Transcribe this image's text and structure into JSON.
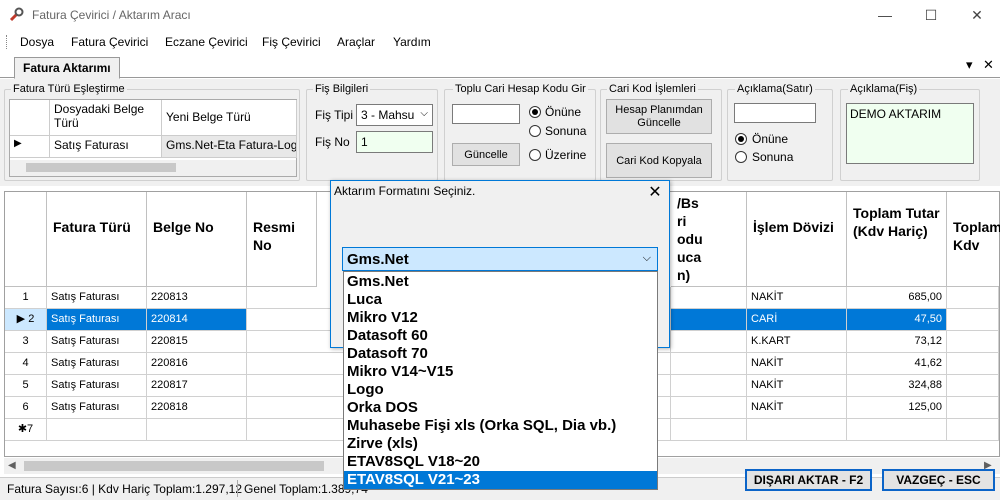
{
  "window": {
    "title": "Fatura Çevirici / Aktarım Aracı",
    "min": "—",
    "max": "☐",
    "close": "✕"
  },
  "menu": [
    "Dosya",
    "Fatura Çevirici",
    "Eczane Çevirici",
    "Fiş Çevirici",
    "Araçlar",
    "Yardım"
  ],
  "tab": {
    "label": "Fatura Aktarımı",
    "dropdown_glyph": "▾",
    "close_glyph": "✕"
  },
  "esleme": {
    "title": "Fatura Türü Eşleştirme",
    "col1": "Dosyadaki Belge Türü",
    "col2": "Yeni Belge Türü",
    "row_marker": "▶",
    "row_col1": "Satış Faturası",
    "row_col2": "Gms.Net-Eta Fatura-Log"
  },
  "fis": {
    "title": "Fiş Bilgileri",
    "tip_label": "Fiş Tipi",
    "tip_value": "3 - Mahsu",
    "no_label": "Fiş No",
    "no_value": "1"
  },
  "toplu": {
    "title": "Toplu Cari Hesap Kodu Gir",
    "button": "Güncelle",
    "options": [
      "Önüne",
      "Sonuna",
      "Üzerine"
    ],
    "selected": 0
  },
  "carikod": {
    "title": "Cari Kod İşlemleri",
    "btn1": "Hesap Planımdan Güncelle",
    "btn2": "Cari Kod Kopyala"
  },
  "aciklama_satir": {
    "title": "Açıklama(Satır)",
    "options": [
      "Önüne",
      "Sonuna"
    ],
    "selected": 0
  },
  "aciklama_fis": {
    "title": "Açıklama(Fiş)",
    "value": "DEMO AKTARIM"
  },
  "grid": {
    "headers": [
      "Fatura Türü",
      "Belge No",
      "Resmi No",
      "İşlem Dövizi",
      "Toplam Tutar (Kdv Hariç)",
      "Toplam Kdv"
    ],
    "hidden_header_fragment": "/Bs\nri\nodu\nuca\nn)",
    "rows": [
      {
        "n": "1",
        "tur": "Satış Faturası",
        "no": "220813",
        "doviz": "NAKİT",
        "tutar": "685,00"
      },
      {
        "n": "2",
        "tur": "Satış Faturası",
        "no": "220814",
        "doviz": "CARİ",
        "tutar": "47,50"
      },
      {
        "n": "3",
        "tur": "Satış Faturası",
        "no": "220815",
        "doviz": "K.KART",
        "tutar": "73,12"
      },
      {
        "n": "4",
        "tur": "Satış Faturası",
        "no": "220816",
        "doviz": "NAKİT",
        "tutar": "41,62"
      },
      {
        "n": "5",
        "tur": "Satış Faturası",
        "no": "220817",
        "doviz": "NAKİT",
        "tutar": "324,88"
      },
      {
        "n": "6",
        "tur": "Satış Faturası",
        "no": "220818",
        "doviz": "NAKİT",
        "tutar": "125,00"
      }
    ],
    "new_row": "7",
    "selected_row": 1
  },
  "status": {
    "count": "Fatura Sayısı:6 | Kdv Hariç Toplam:1.297,12",
    "total": "Genel Toplam:1.389,74"
  },
  "actions": {
    "export": "DIŞARI AKTAR - F2",
    "cancel": "VAZGEÇ - ESC"
  },
  "dialog": {
    "title": "Aktarım Formatını Seçiniz.",
    "selected": "Gms.Net",
    "options": [
      "Gms.Net",
      "Luca",
      "Mikro V12",
      "Datasoft 60",
      "Datasoft 70",
      "Mikro V14~V15",
      "Logo",
      "Orka DOS",
      "Muhasebe Fişi xls (Orka SQL, Dia vb.)",
      "Zirve (xls)",
      "ETAV8SQL V18~20",
      "ETAV8SQL V21~23"
    ],
    "highlighted": 11
  },
  "colors": {
    "accent": "#0078d7",
    "selection": "#0078d7",
    "button_border": "#0b64c8"
  }
}
